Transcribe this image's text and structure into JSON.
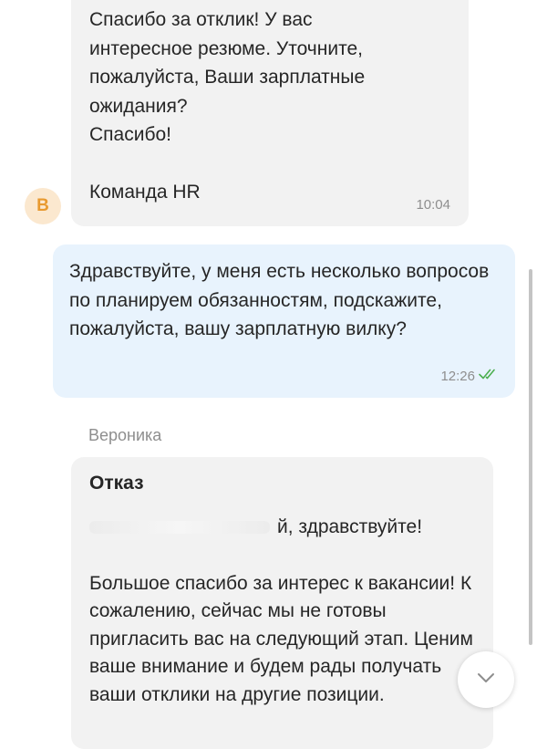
{
  "messages": {
    "incoming_top": {
      "text": "Спасибо за отклик! У вас\nинтересное резюме. Уточните,\nпожалуйста, Ваши зарплатные\nожидания?\nСпасибо!\n\nКоманда HR",
      "time": "10:04",
      "avatar_letter": "В",
      "avatar_color": "#e89a30"
    },
    "outgoing": {
      "text": "Здравствуйте, у меня есть несколько вопросов по планируем обязанностям, подскажите, пожалуйста, вашу зарплатную вилку?",
      "time": "12:26",
      "status_icon": "double-check-icon",
      "status_color": "#4caf50"
    },
    "incoming_bottom": {
      "sender": "Вероника",
      "title": "Отказ",
      "greeting_suffix": "й, здравствуйте!",
      "body": "Большое спасибо за интерес к вакансии! К сожалению, сейчас мы не готовы пригласить вас на следующий этап. Ценим ваше внимание и будем рады получать ваши отклики на другие позиции."
    }
  },
  "controls": {
    "scroll_down_icon": "chevron-down-icon"
  },
  "colors": {
    "incoming_bubble": "#f2f2f2",
    "outgoing_bubble": "#e8f3fd",
    "muted_text": "#8e8e8e"
  }
}
